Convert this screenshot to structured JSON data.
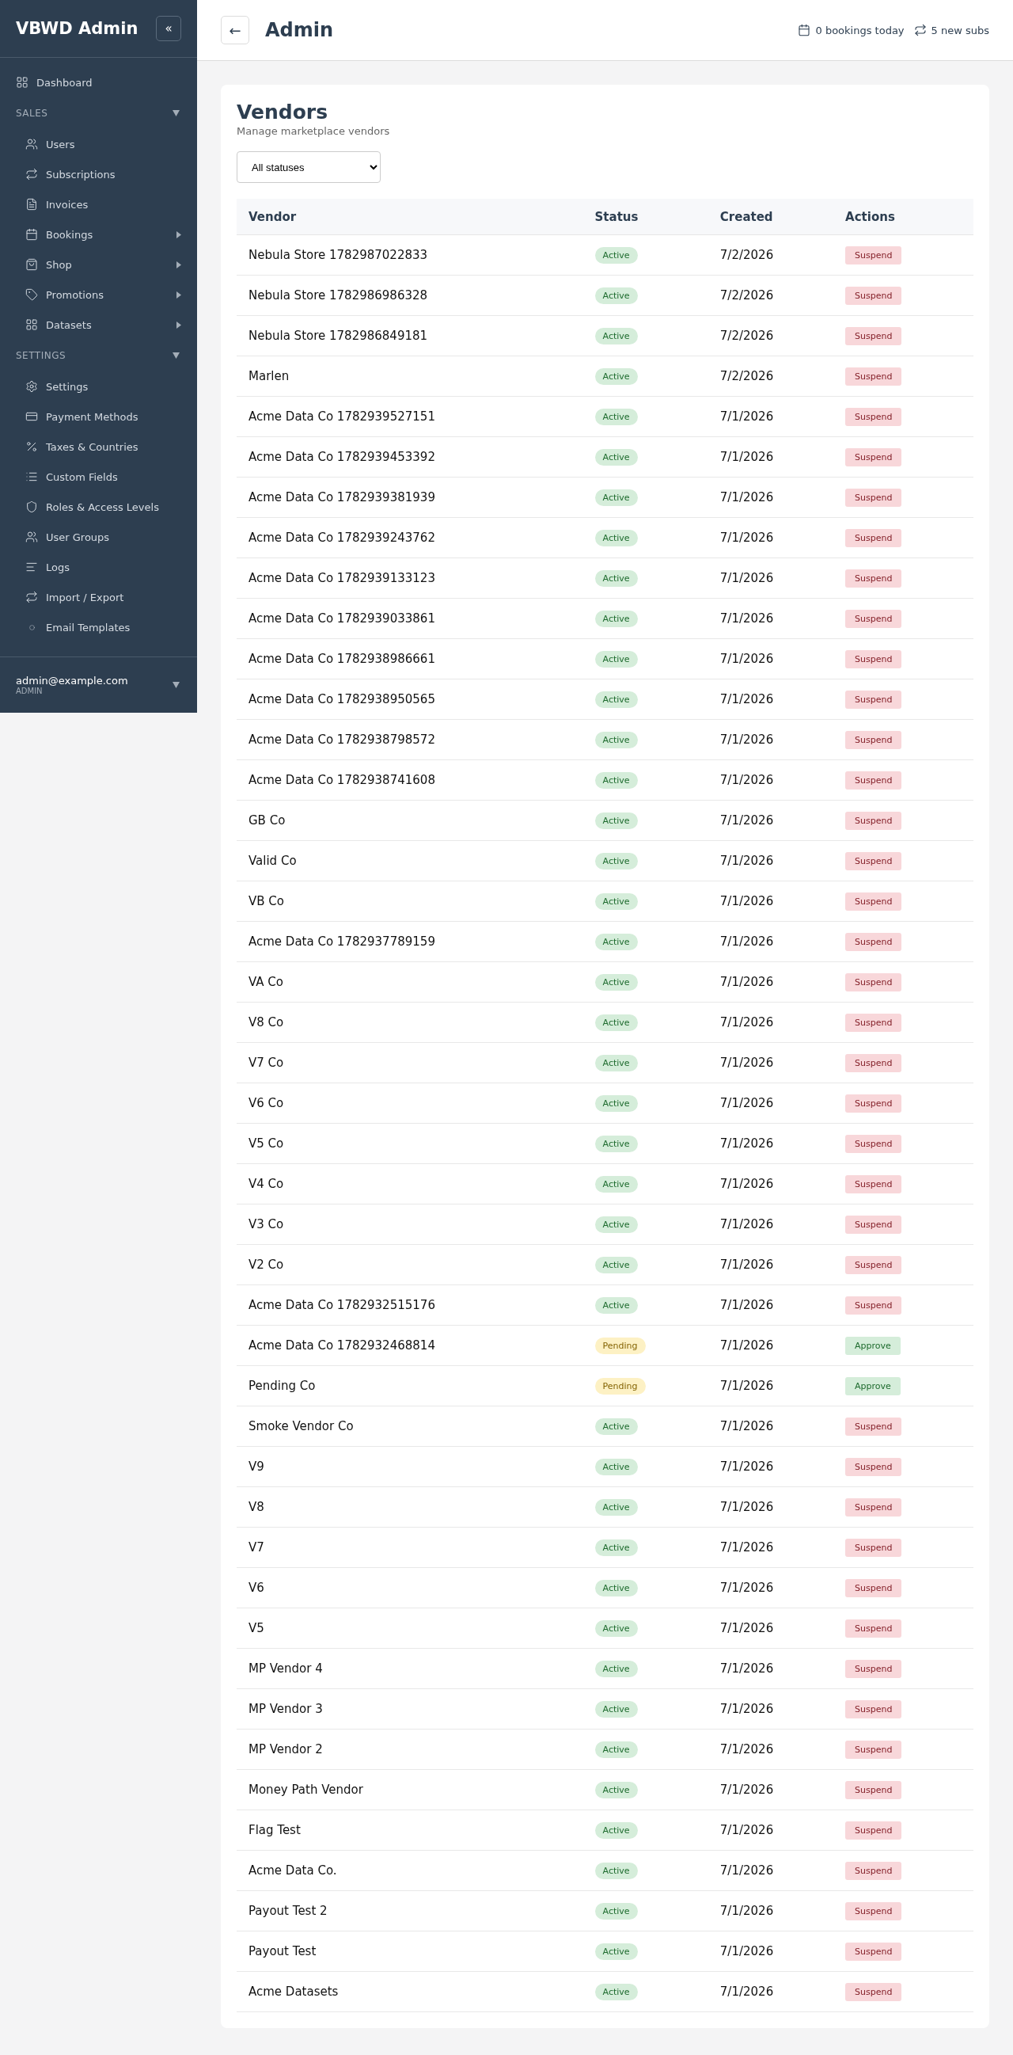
{
  "sidebar": {
    "brand": "VBWD Admin",
    "collapse_label": "«",
    "top_items": [
      {
        "label": "Dashboard",
        "expandable": false
      }
    ],
    "sections": [
      {
        "title": "SALES",
        "expanded": true,
        "items": [
          {
            "label": "Users",
            "expandable": false
          },
          {
            "label": "Subscriptions",
            "expandable": false
          },
          {
            "label": "Invoices",
            "expandable": false
          },
          {
            "label": "Bookings",
            "expandable": true
          },
          {
            "label": "Shop",
            "expandable": true
          },
          {
            "label": "Promotions",
            "expandable": true
          },
          {
            "label": "Datasets",
            "expandable": true
          }
        ]
      },
      {
        "title": "SETTINGS",
        "expanded": true,
        "items": [
          {
            "label": "Settings",
            "expandable": false
          },
          {
            "label": "Payment Methods",
            "expandable": false
          },
          {
            "label": "Taxes & Countries",
            "expandable": false
          },
          {
            "label": "Custom Fields",
            "expandable": false
          },
          {
            "label": "Roles & Access Levels",
            "expandable": false
          },
          {
            "label": "User Groups",
            "expandable": false
          },
          {
            "label": "Logs",
            "expandable": false
          },
          {
            "label": "Import / Export",
            "expandable": false
          },
          {
            "label": "Email Templates",
            "expandable": false
          }
        ]
      }
    ],
    "user": {
      "email": "admin@example.com",
      "role": "ADMIN"
    }
  },
  "header": {
    "back_label": "←",
    "title": "Admin",
    "stats": [
      "0 bookings today",
      "5 new subs"
    ]
  },
  "vendors": {
    "title": "Vendors",
    "subtitle": "Manage marketplace vendors",
    "filter": {
      "value": "All statuses"
    },
    "columns": [
      "Vendor",
      "Status",
      "Created",
      "Actions"
    ],
    "rows": [
      {
        "vendor": "Nebula Store 1782987022833",
        "status": "Active",
        "kind": "active",
        "created": "7/2/2026",
        "action": "Suspend"
      },
      {
        "vendor": "Nebula Store 1782986986328",
        "status": "Active",
        "kind": "active",
        "created": "7/2/2026",
        "action": "Suspend"
      },
      {
        "vendor": "Nebula Store 1782986849181",
        "status": "Active",
        "kind": "active",
        "created": "7/2/2026",
        "action": "Suspend"
      },
      {
        "vendor": "Marlen",
        "status": "Active",
        "kind": "active",
        "created": "7/2/2026",
        "action": "Suspend"
      },
      {
        "vendor": "Acme Data Co 1782939527151",
        "status": "Active",
        "kind": "active",
        "created": "7/1/2026",
        "action": "Suspend"
      },
      {
        "vendor": "Acme Data Co 1782939453392",
        "status": "Active",
        "kind": "active",
        "created": "7/1/2026",
        "action": "Suspend"
      },
      {
        "vendor": "Acme Data Co 1782939381939",
        "status": "Active",
        "kind": "active",
        "created": "7/1/2026",
        "action": "Suspend"
      },
      {
        "vendor": "Acme Data Co 1782939243762",
        "status": "Active",
        "kind": "active",
        "created": "7/1/2026",
        "action": "Suspend"
      },
      {
        "vendor": "Acme Data Co 1782939133123",
        "status": "Active",
        "kind": "active",
        "created": "7/1/2026",
        "action": "Suspend"
      },
      {
        "vendor": "Acme Data Co 1782939033861",
        "status": "Active",
        "kind": "active",
        "created": "7/1/2026",
        "action": "Suspend"
      },
      {
        "vendor": "Acme Data Co 1782938986661",
        "status": "Active",
        "kind": "active",
        "created": "7/1/2026",
        "action": "Suspend"
      },
      {
        "vendor": "Acme Data Co 1782938950565",
        "status": "Active",
        "kind": "active",
        "created": "7/1/2026",
        "action": "Suspend"
      },
      {
        "vendor": "Acme Data Co 1782938798572",
        "status": "Active",
        "kind": "active",
        "created": "7/1/2026",
        "action": "Suspend"
      },
      {
        "vendor": "Acme Data Co 1782938741608",
        "status": "Active",
        "kind": "active",
        "created": "7/1/2026",
        "action": "Suspend"
      },
      {
        "vendor": "GB Co",
        "status": "Active",
        "kind": "active",
        "created": "7/1/2026",
        "action": "Suspend"
      },
      {
        "vendor": "Valid Co",
        "status": "Active",
        "kind": "active",
        "created": "7/1/2026",
        "action": "Suspend"
      },
      {
        "vendor": "VB Co",
        "status": "Active",
        "kind": "active",
        "created": "7/1/2026",
        "action": "Suspend"
      },
      {
        "vendor": "Acme Data Co 1782937789159",
        "status": "Active",
        "kind": "active",
        "created": "7/1/2026",
        "action": "Suspend"
      },
      {
        "vendor": "VA Co",
        "status": "Active",
        "kind": "active",
        "created": "7/1/2026",
        "action": "Suspend"
      },
      {
        "vendor": "V8 Co",
        "status": "Active",
        "kind": "active",
        "created": "7/1/2026",
        "action": "Suspend"
      },
      {
        "vendor": "V7 Co",
        "status": "Active",
        "kind": "active",
        "created": "7/1/2026",
        "action": "Suspend"
      },
      {
        "vendor": "V6 Co",
        "status": "Active",
        "kind": "active",
        "created": "7/1/2026",
        "action": "Suspend"
      },
      {
        "vendor": "V5 Co",
        "status": "Active",
        "kind": "active",
        "created": "7/1/2026",
        "action": "Suspend"
      },
      {
        "vendor": "V4 Co",
        "status": "Active",
        "kind": "active",
        "created": "7/1/2026",
        "action": "Suspend"
      },
      {
        "vendor": "V3 Co",
        "status": "Active",
        "kind": "active",
        "created": "7/1/2026",
        "action": "Suspend"
      },
      {
        "vendor": "V2 Co",
        "status": "Active",
        "kind": "active",
        "created": "7/1/2026",
        "action": "Suspend"
      },
      {
        "vendor": "Acme Data Co 1782932515176",
        "status": "Active",
        "kind": "active",
        "created": "7/1/2026",
        "action": "Suspend"
      },
      {
        "vendor": "Acme Data Co 1782932468814",
        "status": "Pending",
        "kind": "pending",
        "created": "7/1/2026",
        "action": "Approve"
      },
      {
        "vendor": "Pending Co",
        "status": "Pending",
        "kind": "pending",
        "created": "7/1/2026",
        "action": "Approve"
      },
      {
        "vendor": "Smoke Vendor Co",
        "status": "Active",
        "kind": "active",
        "created": "7/1/2026",
        "action": "Suspend"
      },
      {
        "vendor": "V9",
        "status": "Active",
        "kind": "active",
        "created": "7/1/2026",
        "action": "Suspend"
      },
      {
        "vendor": "V8",
        "status": "Active",
        "kind": "active",
        "created": "7/1/2026",
        "action": "Suspend"
      },
      {
        "vendor": "V7",
        "status": "Active",
        "kind": "active",
        "created": "7/1/2026",
        "action": "Suspend"
      },
      {
        "vendor": "V6",
        "status": "Active",
        "kind": "active",
        "created": "7/1/2026",
        "action": "Suspend"
      },
      {
        "vendor": "V5",
        "status": "Active",
        "kind": "active",
        "created": "7/1/2026",
        "action": "Suspend"
      },
      {
        "vendor": "MP Vendor 4",
        "status": "Active",
        "kind": "active",
        "created": "7/1/2026",
        "action": "Suspend"
      },
      {
        "vendor": "MP Vendor 3",
        "status": "Active",
        "kind": "active",
        "created": "7/1/2026",
        "action": "Suspend"
      },
      {
        "vendor": "MP Vendor 2",
        "status": "Active",
        "kind": "active",
        "created": "7/1/2026",
        "action": "Suspend"
      },
      {
        "vendor": "Money Path Vendor",
        "status": "Active",
        "kind": "active",
        "created": "7/1/2026",
        "action": "Suspend"
      },
      {
        "vendor": "Flag Test",
        "status": "Active",
        "kind": "active",
        "created": "7/1/2026",
        "action": "Suspend"
      },
      {
        "vendor": "Acme Data Co.",
        "status": "Active",
        "kind": "active",
        "created": "7/1/2026",
        "action": "Suspend"
      },
      {
        "vendor": "Payout Test 2",
        "status": "Active",
        "kind": "active",
        "created": "7/1/2026",
        "action": "Suspend"
      },
      {
        "vendor": "Payout Test",
        "status": "Active",
        "kind": "active",
        "created": "7/1/2026",
        "action": "Suspend"
      },
      {
        "vendor": "Acme Datasets",
        "status": "Active",
        "kind": "active",
        "created": "7/1/2026",
        "action": "Suspend"
      }
    ]
  }
}
